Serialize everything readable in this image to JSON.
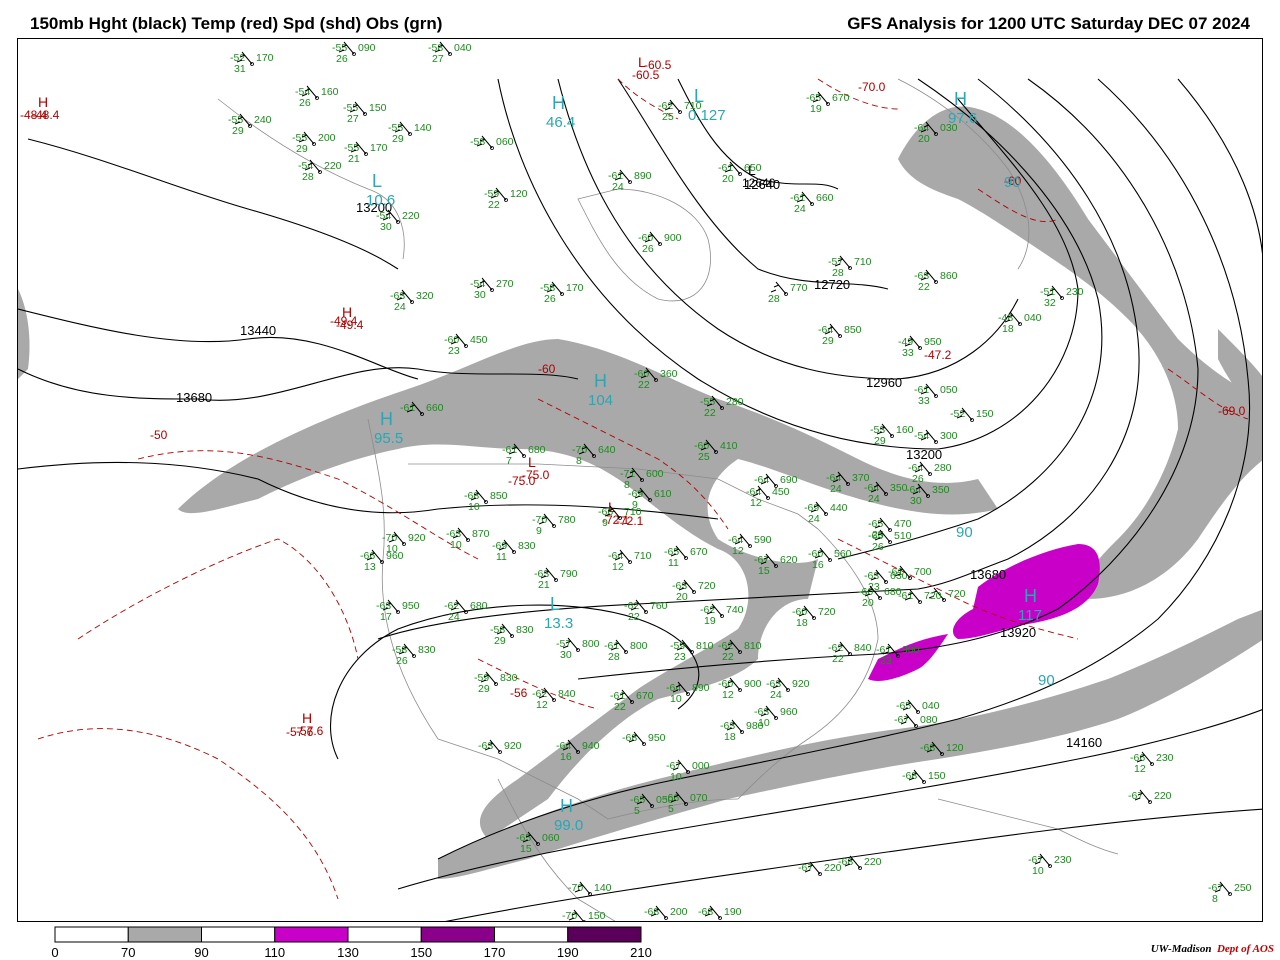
{
  "header": {
    "left_title": "150mb Hght (black) Temp (red) Spd (shd) Obs (grn)",
    "right_title": "GFS Analysis for 1200 UTC Saturday  DEC 07 2024"
  },
  "colorbar": {
    "stops": [
      {
        "from": 0,
        "to": 70,
        "color": "#ffffff"
      },
      {
        "from": 70,
        "to": 90,
        "color": "#a9a9a9"
      },
      {
        "from": 90,
        "to": 110,
        "color": "#ffffff"
      },
      {
        "from": 110,
        "to": 130,
        "color": "#c800c8"
      },
      {
        "from": 130,
        "to": 150,
        "color": "#ffffff"
      },
      {
        "from": 150,
        "to": 170,
        "color": "#8b008b"
      },
      {
        "from": 170,
        "to": 190,
        "color": "#ffffff"
      },
      {
        "from": 190,
        "to": 210,
        "color": "#5a005a"
      }
    ],
    "labels": [
      "0",
      "70",
      "90",
      "110",
      "130",
      "150",
      "170",
      "190",
      "210"
    ]
  },
  "credit": {
    "org": "UW-Madison",
    "dept": "Dept of AOS"
  },
  "colors": {
    "height": "#000000",
    "temp": "#b00000",
    "speed_label": "#2aa6b4",
    "obs": "#1f8a1f",
    "border": "#8c8c8c",
    "shade_70": "#a9a9a9",
    "shade_110": "#c800c8"
  },
  "height_labels": [
    "13200",
    "13440",
    "13680",
    "12640",
    "12720",
    "12960",
    "13200",
    "13680",
    "13920",
    "14160"
  ],
  "temp_labels": [
    "-48.4",
    "-49.4",
    "-50",
    "-60",
    "-60.5",
    "-70.0",
    "-60",
    "-75.0",
    "-72.1",
    "-47.2",
    "-69.0",
    "-56",
    "-57.6"
  ],
  "speed_labels": [
    "90",
    "90",
    "90"
  ],
  "centers": [
    {
      "sym": "H",
      "val": "46.4",
      "kind": "speed"
    },
    {
      "sym": "L",
      "val": "0.127",
      "kind": "speed"
    },
    {
      "sym": "L",
      "val": "10.6",
      "kind": "speed"
    },
    {
      "sym": "H",
      "val": "97.6",
      "kind": "speed"
    },
    {
      "sym": "H",
      "val": "104",
      "kind": "speed"
    },
    {
      "sym": "H",
      "val": "95.5",
      "kind": "speed"
    },
    {
      "sym": "L",
      "val": "13.3",
      "kind": "speed"
    },
    {
      "sym": "H",
      "val": "117",
      "kind": "speed"
    },
    {
      "sym": "H",
      "val": "99.0",
      "kind": "speed"
    },
    {
      "sym": "H",
      "val": "-48.4",
      "kind": "temp"
    },
    {
      "sym": "H",
      "val": "-49.4",
      "kind": "temp"
    },
    {
      "sym": "H",
      "val": "-57.6",
      "kind": "temp"
    },
    {
      "sym": "L",
      "val": "-60.5",
      "kind": "temp"
    },
    {
      "sym": "L",
      "val": "-75.0",
      "kind": "temp"
    },
    {
      "sym": "L",
      "val": "-72.1",
      "kind": "temp"
    },
    {
      "sym": "L",
      "val": "12640",
      "kind": "height"
    }
  ],
  "observations": [
    {
      "t": "-52",
      "h": "170",
      "d": "31"
    },
    {
      "t": "-55",
      "h": "090",
      "d": "26"
    },
    {
      "t": "-58",
      "h": "040",
      "d": "27"
    },
    {
      "t": "-54",
      "h": "160",
      "d": "26"
    },
    {
      "t": "-55",
      "h": "240",
      "d": "29"
    },
    {
      "t": "-55",
      "h": "150",
      "d": "27"
    },
    {
      "t": "-55",
      "h": "140",
      "d": "29"
    },
    {
      "t": "-55",
      "h": "200",
      "d": "29"
    },
    {
      "t": "-54",
      "h": "220",
      "d": "28"
    },
    {
      "t": "-55",
      "h": "170",
      "d": "21"
    },
    {
      "t": "-54",
      "h": "220",
      "d": "30"
    },
    {
      "t": "-58",
      "h": "060",
      "d": ""
    },
    {
      "t": "-59",
      "h": "120",
      "d": "22"
    },
    {
      "t": "-61",
      "h": "890",
      "d": "24"
    },
    {
      "t": "-62",
      "h": "710",
      "d": "25"
    },
    {
      "t": "-61",
      "h": "650",
      "d": "20"
    },
    {
      "t": "-61",
      "h": "660",
      "d": "24"
    },
    {
      "t": "-65",
      "h": "670",
      "d": "19"
    },
    {
      "t": "-64",
      "h": "030",
      "d": "20"
    },
    {
      "t": "-60",
      "h": "900",
      "d": "26"
    },
    {
      "t": "-57",
      "h": "710",
      "d": "28"
    },
    {
      "t": "-63",
      "h": "860",
      "d": "22"
    },
    {
      "t": "-51",
      "h": "230",
      "d": "32"
    },
    {
      "t": "-48",
      "h": "040",
      "d": "18"
    },
    {
      "t": "-54",
      "h": "270",
      "d": "30"
    },
    {
      "t": "-58",
      "h": "170",
      "d": "26"
    },
    {
      "t": "-63",
      "h": "320",
      "d": "24"
    },
    {
      "t": "",
      "h": "770",
      "d": "28"
    },
    {
      "t": "-64",
      "h": "850",
      "d": "29"
    },
    {
      "t": "-49",
      "h": "950",
      "d": "33"
    },
    {
      "t": "-60",
      "h": "450",
      "d": "23"
    },
    {
      "t": "-60",
      "h": "360",
      "d": "22"
    },
    {
      "t": "-61",
      "h": "050",
      "d": "33"
    },
    {
      "t": "-52",
      "h": "150",
      "d": ""
    },
    {
      "t": "-55",
      "h": "280",
      "d": "22"
    },
    {
      "t": "-53",
      "h": "160",
      "d": "29"
    },
    {
      "t": "-54",
      "h": "300",
      "d": ""
    },
    {
      "t": "-61",
      "h": "660",
      "d": ""
    },
    {
      "t": "-60",
      "h": "410",
      "d": "25"
    },
    {
      "t": "-64",
      "h": "280",
      "d": "26"
    },
    {
      "t": "-61",
      "h": "680",
      "d": "7"
    },
    {
      "t": "-70",
      "h": "640",
      "d": "8"
    },
    {
      "t": "-71",
      "h": "600",
      "d": "8"
    },
    {
      "t": "-64",
      "h": "690",
      "d": ""
    },
    {
      "t": "-64",
      "h": "370",
      "d": "24"
    },
    {
      "t": "-64",
      "h": "350",
      "d": "24"
    },
    {
      "t": "-64",
      "h": "350",
      "d": "30"
    },
    {
      "t": "-64",
      "h": "450",
      "d": "12"
    },
    {
      "t": "-69",
      "h": "440",
      "d": "24"
    },
    {
      "t": "-69",
      "h": "610",
      "d": "9"
    },
    {
      "t": "-68",
      "h": "850",
      "d": "10"
    },
    {
      "t": "-70",
      "h": "780",
      "d": "9"
    },
    {
      "t": "-66",
      "h": "710",
      "d": "9"
    },
    {
      "t": "-65",
      "h": "470",
      "d": "25"
    },
    {
      "t": "-65",
      "h": "510",
      "d": "26"
    },
    {
      "t": "-63",
      "h": "870",
      "d": "10"
    },
    {
      "t": "-69",
      "h": "830",
      "d": "11"
    },
    {
      "t": "-64",
      "h": "710",
      "d": "12"
    },
    {
      "t": "-65",
      "h": "670",
      "d": "11"
    },
    {
      "t": "-64",
      "h": "590",
      "d": "12"
    },
    {
      "t": "-67",
      "h": "620",
      "d": "15"
    },
    {
      "t": "-60",
      "h": "560",
      "d": "16"
    },
    {
      "t": "-70",
      "h": "920",
      "d": "10"
    },
    {
      "t": "-66",
      "h": "960",
      "d": "13"
    },
    {
      "t": "-63",
      "h": "790",
      "d": "21"
    },
    {
      "t": "-63",
      "h": "720",
      "d": "20"
    },
    {
      "t": "-63",
      "h": "630",
      "d": "23"
    },
    {
      "t": "-60",
      "h": "680",
      "d": "20"
    },
    {
      "t": "",
      "h": "720",
      "d": ""
    },
    {
      "t": "-63",
      "h": "950",
      "d": "17"
    },
    {
      "t": "-62",
      "h": "680",
      "d": "24"
    },
    {
      "t": "-62",
      "h": "760",
      "d": "22"
    },
    {
      "t": "-62",
      "h": "740",
      "d": "19"
    },
    {
      "t": "-60",
      "h": "720",
      "d": "18"
    },
    {
      "t": "-58",
      "h": "830",
      "d": "29"
    },
    {
      "t": "-57",
      "h": "800",
      "d": "30"
    },
    {
      "t": "-61",
      "h": "800",
      "d": "28"
    },
    {
      "t": "-59",
      "h": "810",
      "d": "23"
    },
    {
      "t": "-62",
      "h": "810",
      "d": "22"
    },
    {
      "t": "-62",
      "h": "840",
      "d": "22"
    },
    {
      "t": "-61",
      "h": "900",
      "d": "23"
    },
    {
      "t": "-58",
      "h": "830",
      "d": "26"
    },
    {
      "t": "-59",
      "h": "830",
      "d": "29"
    },
    {
      "t": "-62",
      "h": "840",
      "d": "12"
    },
    {
      "t": "-61",
      "h": "670",
      "d": "22"
    },
    {
      "t": "-64",
      "h": "890",
      "d": "10"
    },
    {
      "t": "-60",
      "h": "900",
      "d": "12"
    },
    {
      "t": "-63",
      "h": "920",
      "d": "24"
    },
    {
      "t": "-63",
      "h": "920",
      "d": ""
    },
    {
      "t": "-64",
      "h": "940",
      "d": "16"
    },
    {
      "t": "-68",
      "h": "950",
      "d": ""
    },
    {
      "t": "-63",
      "h": "980",
      "d": "18"
    },
    {
      "t": "-63",
      "h": "960",
      "d": "10"
    },
    {
      "t": "-65",
      "h": "040",
      "d": ""
    },
    {
      "t": "-67",
      "h": "080",
      "d": ""
    },
    {
      "t": "-68",
      "h": "120",
      "d": ""
    },
    {
      "t": "-68",
      "h": "150",
      "d": ""
    },
    {
      "t": "-67",
      "h": "000",
      "d": "10"
    },
    {
      "t": "-65",
      "h": "050",
      "d": "5"
    },
    {
      "t": "-66",
      "h": "070",
      "d": "5"
    },
    {
      "t": "-65",
      "h": "060",
      "d": "15"
    },
    {
      "t": "-70",
      "h": "140",
      "d": ""
    },
    {
      "t": "-70",
      "h": "150",
      "d": ""
    },
    {
      "t": "-68",
      "h": "200",
      "d": ""
    },
    {
      "t": "-68",
      "h": "190",
      "d": ""
    },
    {
      "t": "-67",
      "h": "220",
      "d": ""
    },
    {
      "t": "-68",
      "h": "220",
      "d": ""
    },
    {
      "t": "-67",
      "h": "230",
      "d": "10"
    },
    {
      "t": "-67",
      "h": "220",
      "d": ""
    },
    {
      "t": "-66",
      "h": "230",
      "d": "12"
    },
    {
      "t": "-67",
      "h": "250",
      "d": "8"
    },
    {
      "t": "-61",
      "h": "720",
      "d": ""
    },
    {
      "t": "-61",
      "h": "700",
      "d": ""
    }
  ]
}
